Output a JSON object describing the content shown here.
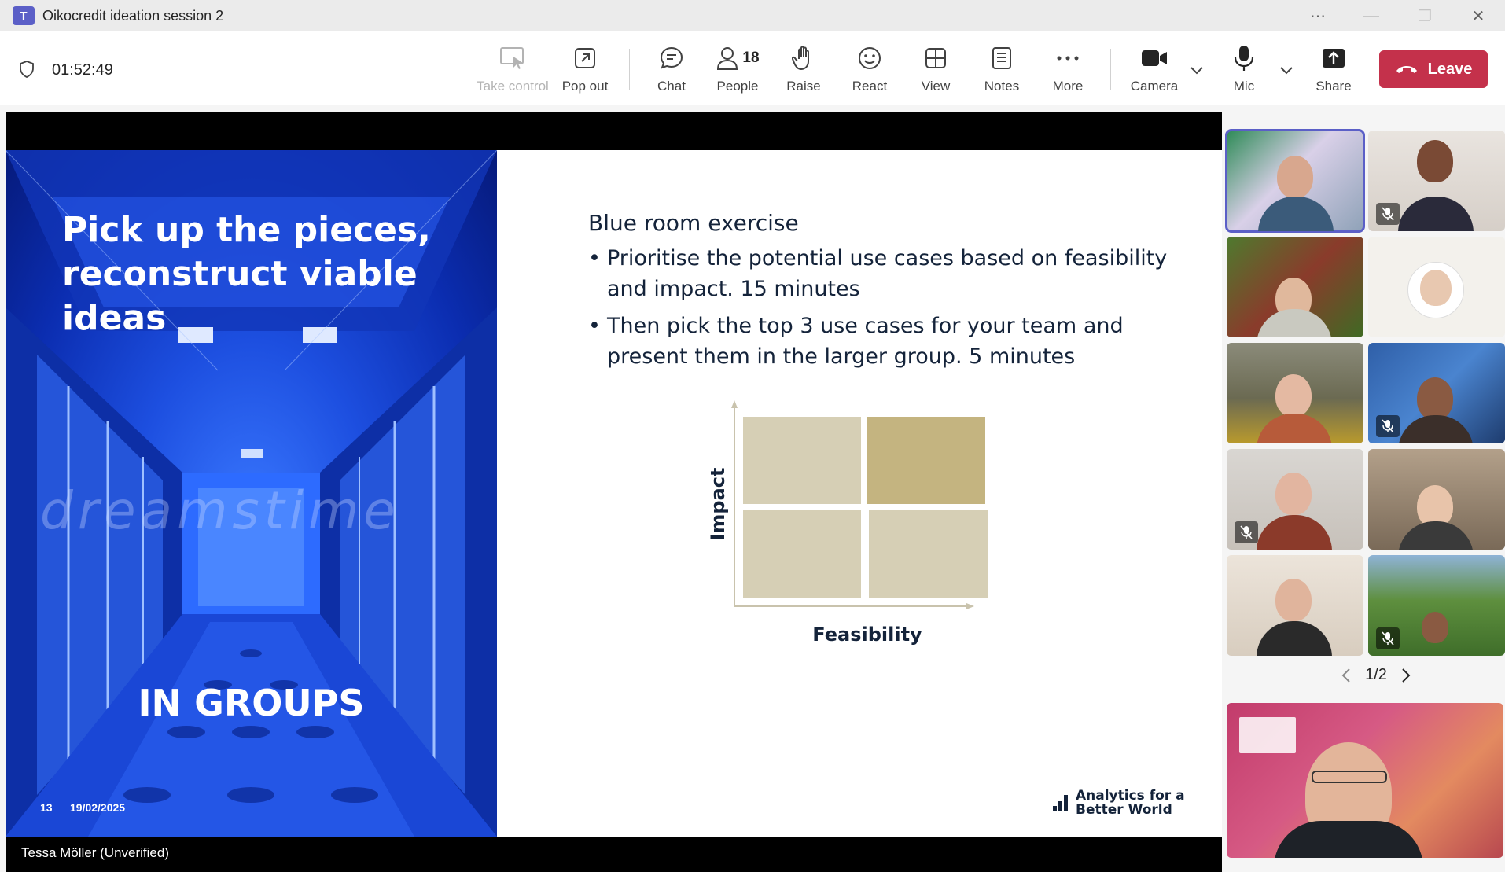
{
  "window": {
    "title": "Oikocredit ideation session 2",
    "app_icon": "teams-icon",
    "controls": [
      "more-options-icon",
      "minimize-icon",
      "restore-icon",
      "close-icon"
    ]
  },
  "toolbar": {
    "timer": "01:52:49",
    "take_control": "Take control",
    "pop_out": "Pop out",
    "chat": "Chat",
    "people": "People",
    "people_count": "18",
    "raise": "Raise",
    "react": "React",
    "view": "View",
    "notes": "Notes",
    "more": "More",
    "camera": "Camera",
    "mic": "Mic",
    "share": "Share",
    "leave": "Leave"
  },
  "slide": {
    "heading": "Pick up the pieces, reconstruct viable ideas",
    "watermark": "dreamstime",
    "groups_label": "IN GROUPS",
    "slide_number": "13",
    "date": "19/02/2025",
    "exercise_title": "Blue room exercise",
    "bullets": [
      "Prioritise the potential use cases based on feasibility and impact. 15 minutes",
      "Then pick the top 3 use cases for your team and present them in the larger group. 5 minutes"
    ],
    "matrix": {
      "y_axis_label": "Impact",
      "x_axis_label": "Feasibility",
      "highlight_color": "#c4b480",
      "cell_color": "#d6cfb5"
    },
    "brand_line1": "Analytics for a",
    "brand_line2": "Better World"
  },
  "presenter_name": "Tessa Möller (Unverified)",
  "gallery": {
    "page_indicator": "1/2",
    "tile_count": 10
  },
  "colors": {
    "accent": "#5b5fc7",
    "leave": "#c4314b",
    "slide_text": "#14233a"
  }
}
